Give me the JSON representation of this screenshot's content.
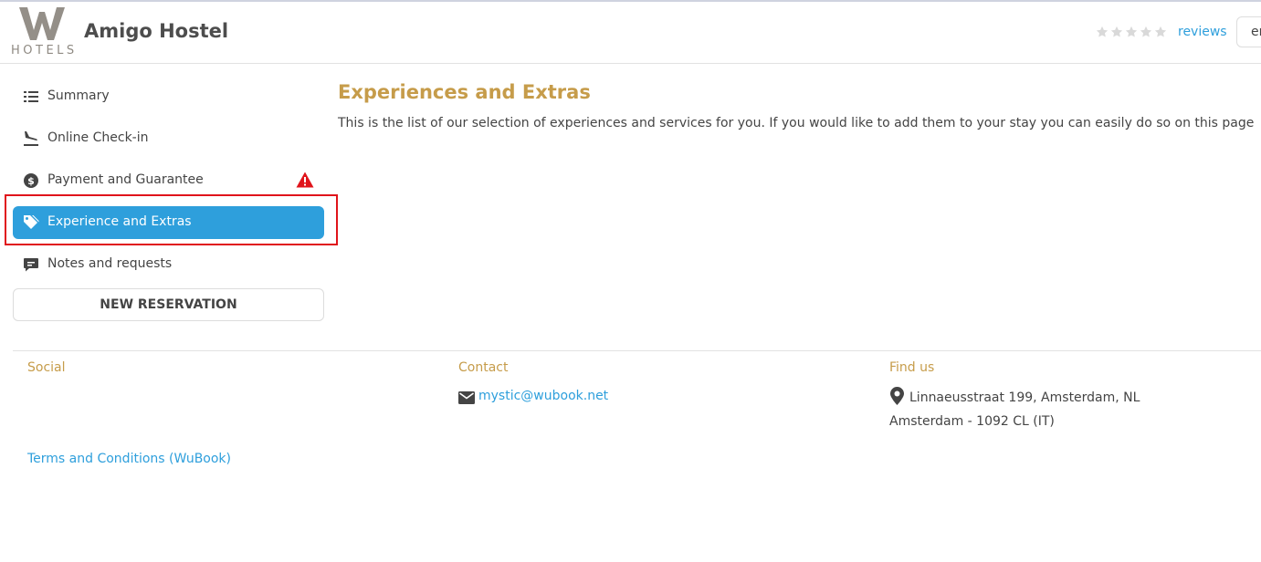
{
  "header": {
    "logo_letter": "W",
    "logo_text": "HOTELS",
    "hotel_name": "Amigo Hostel",
    "rating_stars": 0,
    "rating_max": 5,
    "reviews_label": "reviews",
    "language_value": "en"
  },
  "sidebar": {
    "items": [
      {
        "label": "Summary",
        "icon": "list-icon",
        "active": false
      },
      {
        "label": "Online Check-in",
        "icon": "plane-landing-icon",
        "active": false
      },
      {
        "label": "Payment and Guarantee",
        "icon": "dollar-circle-icon",
        "active": false,
        "warning": true
      },
      {
        "label": "Experience and Extras",
        "icon": "tag-icon",
        "active": true
      },
      {
        "label": "Notes and requests",
        "icon": "comment-icon",
        "active": false
      }
    ],
    "new_reservation_label": "NEW RESERVATION"
  },
  "main": {
    "title": "Experiences and Extras",
    "description": "This is the list of our selection of experiences and services for you. If you would like to add them to your stay you can easily do so on this page"
  },
  "footer": {
    "social_heading": "Social",
    "contact_heading": "Contact",
    "contact_email": "mystic@wubook.net",
    "findus_heading": "Find us",
    "address_line1": "Linnaeusstraat 199, Amsterdam, NL",
    "address_line2": "Amsterdam - 1092 CL (IT)",
    "terms_label": "Terms and Conditions (WuBook)"
  },
  "colors": {
    "accent_blue": "#2e9fdc",
    "heading_gold": "#c69c4a",
    "warning_red": "#e0141b"
  }
}
